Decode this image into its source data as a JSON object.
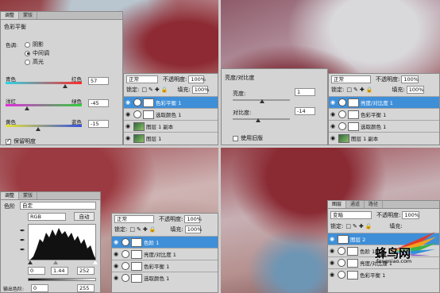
{
  "q1": {
    "tabs": [
      "调整",
      "蒙版"
    ],
    "title": "色彩平衡",
    "tone_label": "色调:",
    "tones": [
      "阴影",
      "中间调",
      "高光"
    ],
    "tone_selected": 1,
    "sliders": [
      {
        "left": "青色",
        "right": "红色",
        "value": "57",
        "pos": 0.78
      },
      {
        "left": "洋红",
        "right": "绿色",
        "value": "-45",
        "pos": 0.28
      },
      {
        "left": "黄色",
        "right": "蓝色",
        "value": "-15",
        "pos": 0.43
      }
    ],
    "preserve": "保留明度",
    "blend_mode": "正常",
    "opacity_label": "不透明度:",
    "opacity": "100%",
    "lock_label": "锁定:",
    "fill_label": "填充:",
    "fill": "100%",
    "layers": [
      {
        "name": "色彩平衡 1",
        "kind": "adj",
        "selected": true
      },
      {
        "name": "选取颜色 1",
        "kind": "adj",
        "selected": false
      },
      {
        "name": "图层 1 副本",
        "kind": "img",
        "selected": false
      },
      {
        "name": "图层 1",
        "kind": "img",
        "selected": false
      }
    ]
  },
  "q2": {
    "title": "亮度/对比度",
    "brightness_label": "亮度:",
    "brightness": "1",
    "contrast_label": "对比度:",
    "contrast": "-14",
    "legacy": "使用旧版",
    "blend_mode": "正常",
    "opacity_label": "不透明度:",
    "opacity": "100%",
    "lock_label": "锁定:",
    "fill_label": "填充:",
    "fill": "100%",
    "layers": [
      {
        "name": "亮度/对比度 1",
        "kind": "adj",
        "selected": true
      },
      {
        "name": "色彩平衡 1",
        "kind": "adj",
        "selected": false
      },
      {
        "name": "选取颜色 1",
        "kind": "adj",
        "selected": false
      },
      {
        "name": "图层 1 副本",
        "kind": "img",
        "selected": false
      }
    ]
  },
  "q3": {
    "tabs": [
      "调整",
      "蒙版"
    ],
    "levels_label": "色阶",
    "preset": "自定",
    "channel": "RGB",
    "auto": "自动",
    "inputs": [
      "0",
      "1.44",
      "252"
    ],
    "output_label": "输出色阶:",
    "outputs": [
      "0",
      "255"
    ],
    "blend_mode": "正常",
    "opacity_label": "不透明度:",
    "opacity": "100%",
    "lock_label": "锁定:",
    "fill_label": "填充:",
    "fill": "100%",
    "layers": [
      {
        "name": "色阶 1",
        "kind": "adj",
        "selected": true
      },
      {
        "name": "亮度/对比度 1",
        "kind": "adj",
        "selected": false
      },
      {
        "name": "色彩平衡 1",
        "kind": "adj",
        "selected": false
      },
      {
        "name": "选取颜色 1",
        "kind": "adj",
        "selected": false
      }
    ]
  },
  "q4": {
    "tabs": [
      "图层",
      "通道",
      "路径"
    ],
    "blend_mode": "变暗",
    "opacity_label": "不透明度:",
    "opacity": "100%",
    "lock_label": "锁定:",
    "fill_label": "填充:",
    "layers": [
      {
        "name": "图层 2",
        "kind": "white",
        "selected": true
      },
      {
        "name": "色阶 1",
        "kind": "adj",
        "selected": false
      },
      {
        "name": "亮度/对比度 1",
        "kind": "adj",
        "selected": false
      },
      {
        "name": "色彩平衡 1",
        "kind": "adj",
        "selected": false
      }
    ],
    "watermark_cn": "蜂鸟网",
    "watermark_en": "fengniao.com"
  }
}
